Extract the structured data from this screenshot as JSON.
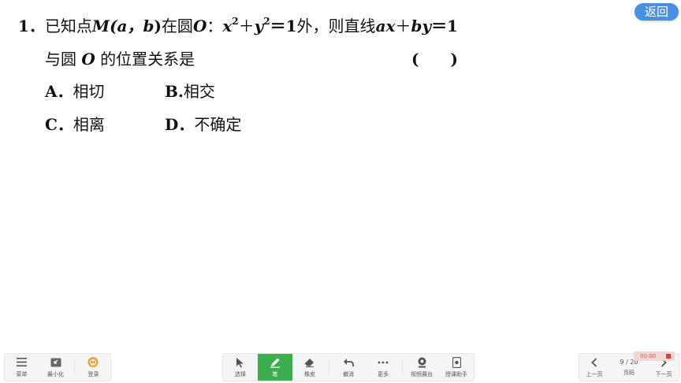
{
  "question": {
    "number": "1．",
    "prefix": "已知点",
    "M": "M",
    "paren_a": "(a，",
    "b": "b",
    "close": ")",
    "in_circle": "在圆",
    "O": "O",
    "colon": "：",
    "x": "x",
    "exp1": "2",
    "plus1": "＋",
    "y": "y",
    "exp2": "2",
    "eq1": "＝1",
    "mid": "外，则直线",
    "ax": "ax",
    "plus2": "＋",
    "by": "by",
    "eq2": "＝1",
    "line2_prefix": "与圆",
    "O2": "O",
    "line2_suffix": "的位置关系是",
    "blank": "(　　)"
  },
  "options": [
    {
      "letter": "A．",
      "text": "相切"
    },
    {
      "letter": "B.",
      "text": "相交"
    },
    {
      "letter": "C．",
      "text": "相离"
    },
    {
      "letter": "D．",
      "text": "不确定"
    }
  ],
  "back_button": "返回",
  "left_toolbar": [
    {
      "label": "菜单",
      "icon": "menu-icon"
    },
    {
      "label": "最小化",
      "icon": "minimize-icon"
    },
    {
      "label": "登录",
      "icon": "avatar-icon"
    }
  ],
  "center_toolbar": [
    {
      "label": "选择",
      "icon": "cursor-icon"
    },
    {
      "label": "笔",
      "icon": "pen-icon",
      "active": true
    },
    {
      "label": "橡皮",
      "icon": "eraser-icon"
    },
    {
      "label": "撤消",
      "icon": "undo-icon"
    },
    {
      "label": "更多",
      "icon": "more-icon"
    },
    {
      "label": "视频展台",
      "icon": "camera-icon"
    },
    {
      "label": "授课助手",
      "icon": "assistant-icon"
    }
  ],
  "right_toolbar": {
    "prev_label": "上一页",
    "page_counter": "9 / 20",
    "page_label": "页码",
    "next_label": "下一页"
  },
  "record_time": "00:00",
  "colors": {
    "active": "#3dae4f",
    "back": "#4a90e2",
    "record": "#e53935"
  }
}
